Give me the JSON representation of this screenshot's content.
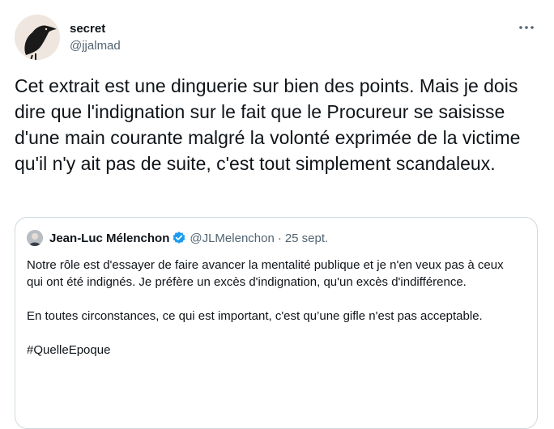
{
  "author": {
    "display_name": "secret",
    "handle": "@jjalmad",
    "avatar_icon": "crow-avatar",
    "more_icon": "more-horizontal-icon"
  },
  "tweet": {
    "text": "Cet extrait est une dinguerie sur bien des points. Mais je dois dire que l'indignation sur le fait que le Procureur se saisisse d'une main courante malgré la volonté exprimée de la victime qu'il n'y ait pas de suite, c'est tout simplement scandaleux."
  },
  "quoted_tweet": {
    "display_name": "Jean-Luc Mélenchon",
    "verified": true,
    "handle": "@JLMelenchon",
    "separator": "·",
    "date": "25 sept.",
    "paragraph1": "Notre rôle est d'essayer de faire avancer la mentalité publique et je n'en veux pas à ceux qui ont été indignés. Je préfère un excès d'indignation, qu'un excès d'indifférence.",
    "paragraph2": "En toutes circonstances, ce qui est important, c'est qu’une gifle n'est pas acceptable.",
    "hashtag": "#QuelleEpoque"
  },
  "colors": {
    "text": "#0f1419",
    "secondary": "#536471",
    "border": "#cfd9de",
    "verified_blue": "#1d9bf0"
  }
}
